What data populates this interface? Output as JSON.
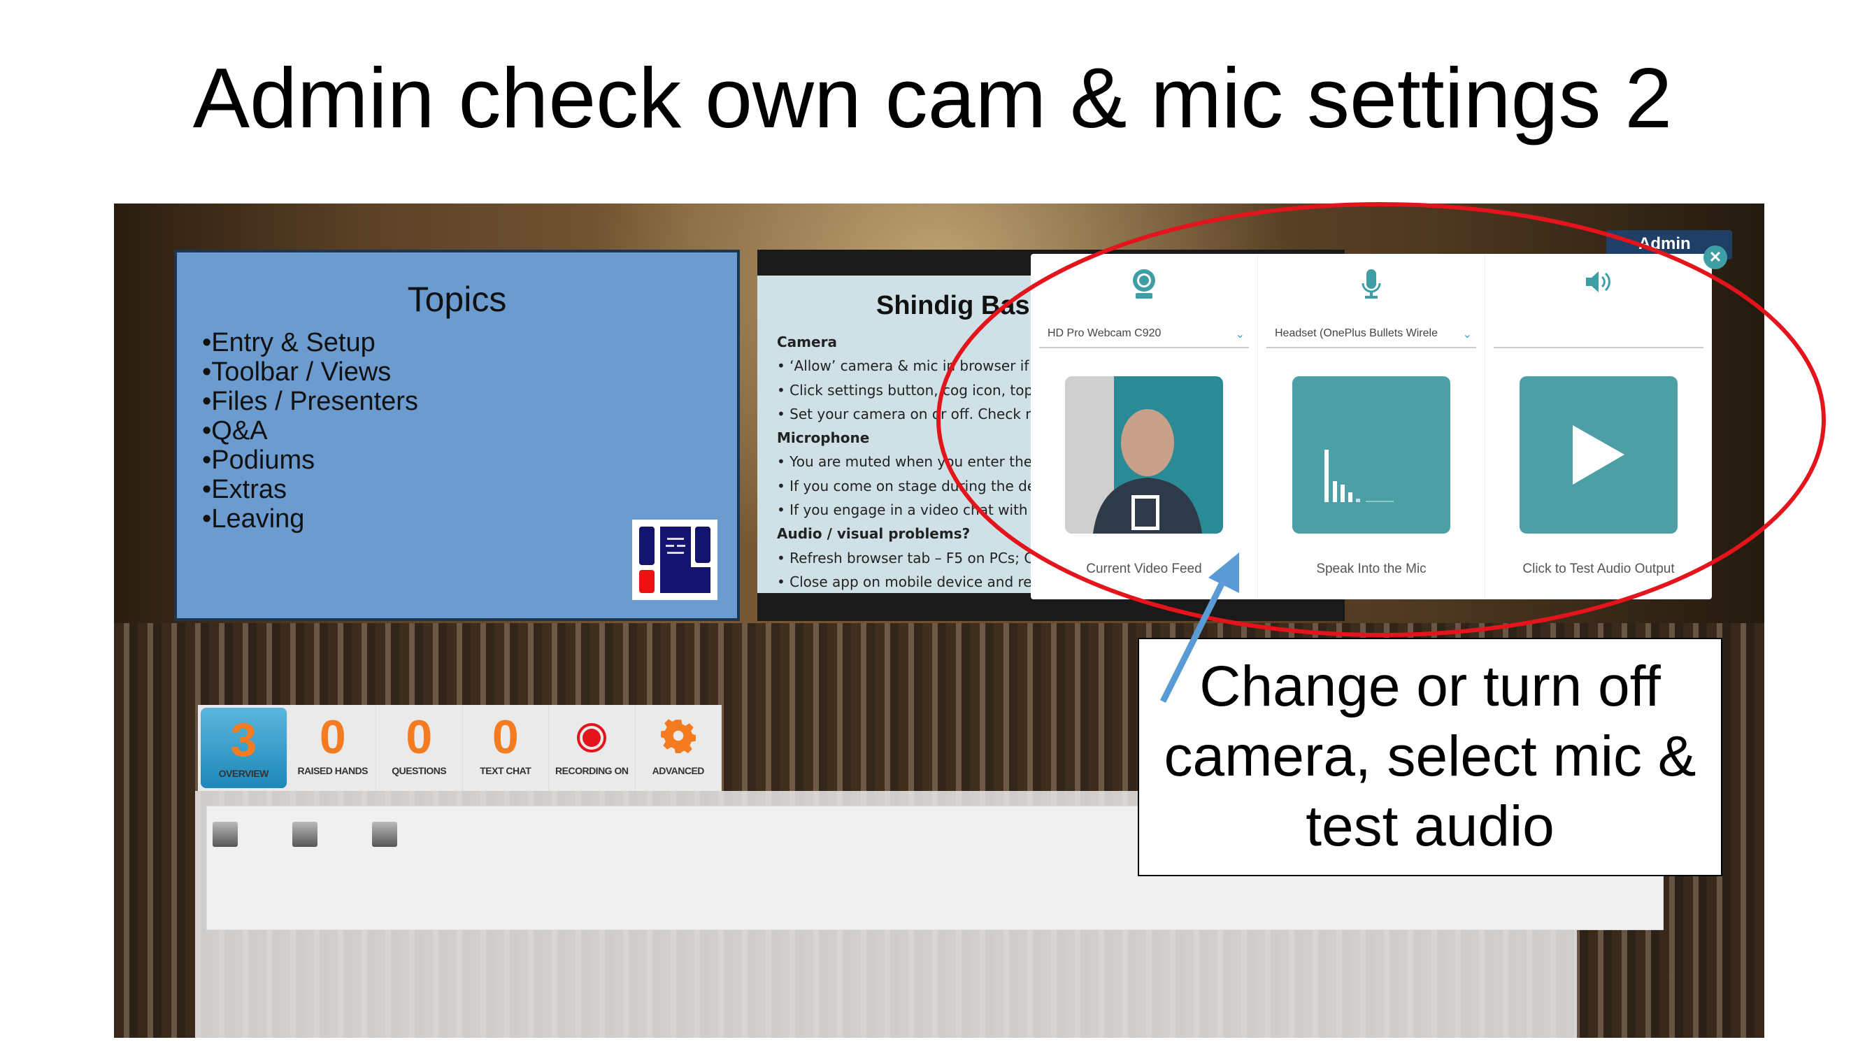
{
  "slide_title": "Admin check own cam & mic settings 2",
  "topics": {
    "title": "Topics",
    "items": [
      "•Entry & Setup",
      "•Toolbar / Views",
      "•Files / Presenters",
      "•Q&A",
      "•Podiums",
      "•Extras",
      "•Leaving"
    ]
  },
  "shindig": {
    "title": "Shindig Basi",
    "lines": [
      {
        "t": "Camera",
        "h": true
      },
      {
        "t": "• ‘Allow’ camera & mic in browser if p"
      },
      {
        "t": "• Click settings button, cog icon, top r"
      },
      {
        "t": "• Set your camera on or off. Check mi"
      },
      {
        "t": "Microphone",
        "h": true
      },
      {
        "t": "• You are muted when you enter the"
      },
      {
        "t": "• If you come on stage during the der"
      },
      {
        "t": "• If you engage in a video chat with ot"
      },
      {
        "t": "Audio / visual problems?",
        "h": true
      },
      {
        "t": "• Refresh browser tab – F5 on PCs; C"
      },
      {
        "t": "• Close app on mobile device and re-e"
      }
    ]
  },
  "settings": {
    "camera": {
      "device": "HD Pro Webcam C920",
      "caption": "Current Video Feed"
    },
    "mic": {
      "device": "Headset (OnePlus Bullets Wirele",
      "caption": "Speak Into the Mic"
    },
    "speaker": {
      "device": "",
      "caption": "Click to Test Audio Output"
    },
    "admin_label": "Admin",
    "close": "✕",
    "chevron": "⌄"
  },
  "toolbar": [
    {
      "value": "3",
      "label": "OVERVIEW"
    },
    {
      "value": "0",
      "label": "RAISED HANDS"
    },
    {
      "value": "0",
      "label": "QUESTIONS"
    },
    {
      "value": "0",
      "label": "TEXT CHAT"
    },
    {
      "value": "",
      "label": "RECORDING ON"
    },
    {
      "value": "",
      "label": "ADVANCED"
    }
  ],
  "callout": "Change or turn off camera, select mic & test audio",
  "colors": {
    "teal": "#4d9fa6",
    "orange": "#f47b20",
    "annotation_red": "#e3141b",
    "arrow_blue": "#5b9bd5"
  }
}
